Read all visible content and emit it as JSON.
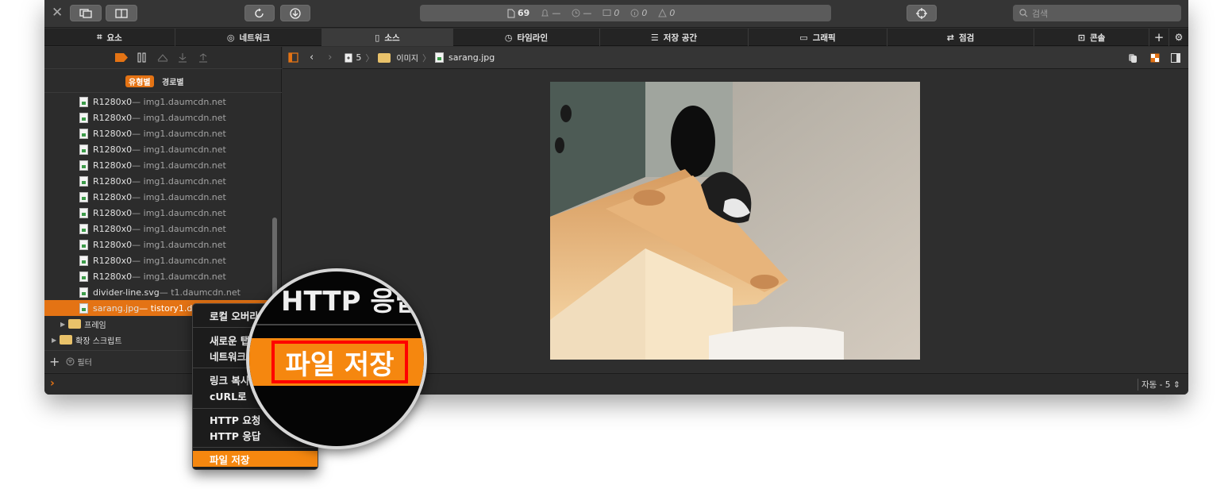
{
  "toolbar": {
    "close_icon": "close-icon",
    "resource_count": "69",
    "dash1": "—",
    "dash2": "—",
    "errors": "0",
    "info": "0",
    "warnings": "0",
    "search_placeholder": "검색"
  },
  "tabs": [
    {
      "label": "요소",
      "icon": "elements-icon"
    },
    {
      "label": "네트워크",
      "icon": "network-icon"
    },
    {
      "label": "소스",
      "icon": "document-icon"
    },
    {
      "label": "타임라인",
      "icon": "clock-icon"
    },
    {
      "label": "저장 공간",
      "icon": "database-icon"
    },
    {
      "label": "그래픽",
      "icon": "image-icon"
    },
    {
      "label": "점검",
      "icon": "audit-icon"
    },
    {
      "label": "콘솔",
      "icon": "terminal-icon"
    }
  ],
  "sidebar": {
    "grouping": {
      "by_type": "유형별",
      "by_path": "경로별"
    },
    "items": [
      {
        "name": "R1280x0",
        "domain": " — img1.daumcdn.net"
      },
      {
        "name": "R1280x0",
        "domain": " — img1.daumcdn.net"
      },
      {
        "name": "R1280x0",
        "domain": " — img1.daumcdn.net"
      },
      {
        "name": "R1280x0",
        "domain": " — img1.daumcdn.net"
      },
      {
        "name": "R1280x0",
        "domain": " — img1.daumcdn.net"
      },
      {
        "name": "R1280x0",
        "domain": " — img1.daumcdn.net"
      },
      {
        "name": "R1280x0",
        "domain": " — img1.daumcdn.net"
      },
      {
        "name": "R1280x0",
        "domain": " — img1.daumcdn.net"
      },
      {
        "name": "R1280x0",
        "domain": " — img1.daumcdn.net"
      },
      {
        "name": "R1280x0",
        "domain": " — img1.daumcdn.net"
      },
      {
        "name": "R1280x0",
        "domain": " — img1.daumcdn.net"
      },
      {
        "name": "R1280x0",
        "domain": " — img1.daumcdn.net"
      },
      {
        "name": "divider-line.svg",
        "domain": " — t1.daumcdn.net"
      },
      {
        "name": "sarang.jpg",
        "domain": " — tistory1.da"
      }
    ],
    "folders": [
      {
        "label": "프레임"
      },
      {
        "label": "확장 스크립트"
      }
    ],
    "filter_placeholder": "필터"
  },
  "breadcrumb": {
    "frame": "5",
    "folder": "이미지",
    "file": "sarang.jpg"
  },
  "console": {
    "prompt": "›",
    "context": "자동 - 5"
  },
  "context_menu": {
    "items": [
      "로컬 오버라",
      "새로운 탭",
      "네트워크",
      "링크 복사",
      "cURL로",
      "HTTP 요청",
      "HTTP 응답",
      "파일 저장"
    ],
    "highlighted": "파일 저장"
  },
  "magnifier": {
    "top_text": "HTTP 응답",
    "highlight_text": "파일 저장",
    "box_color": "#ff0000"
  },
  "colors": {
    "accent": "#e47314",
    "highlight_red": "#ff0000"
  }
}
